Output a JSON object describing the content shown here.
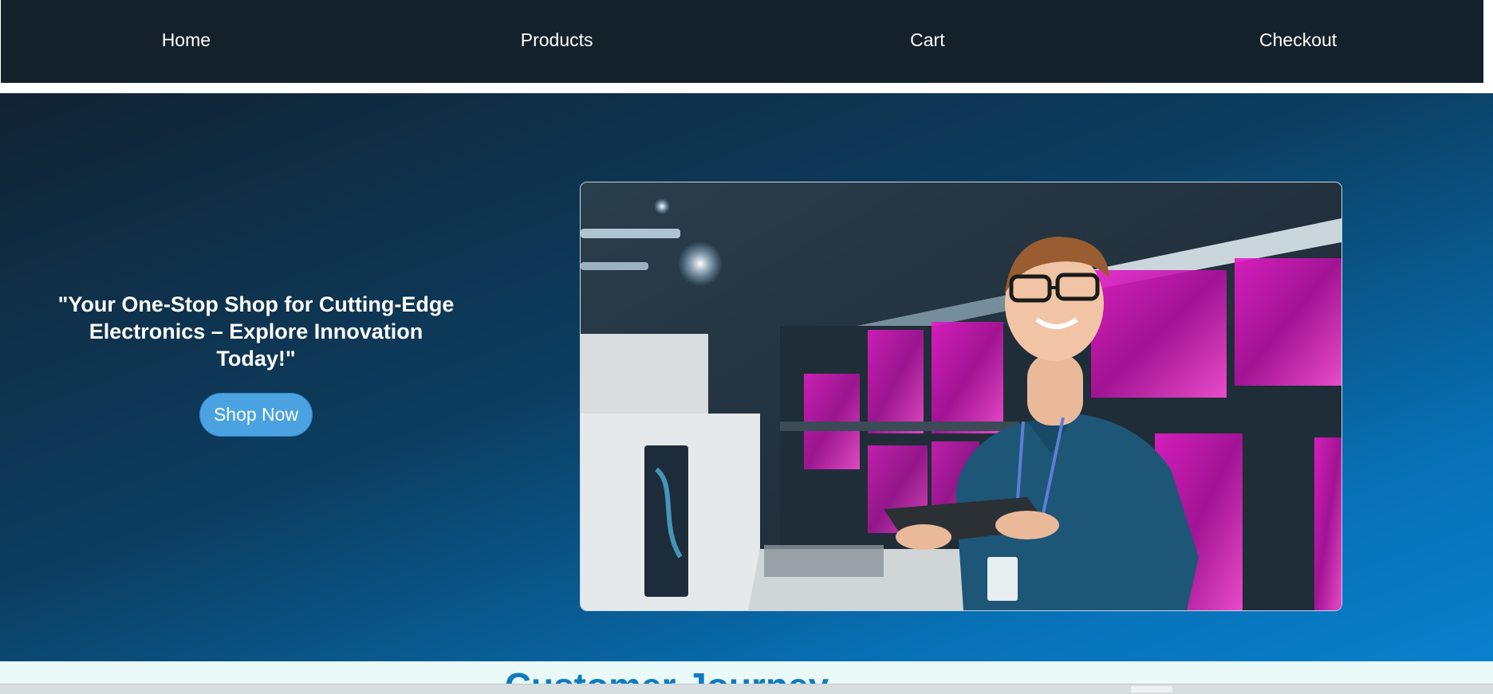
{
  "nav": {
    "items": [
      {
        "label": "Home"
      },
      {
        "label": "Products"
      },
      {
        "label": "Cart"
      },
      {
        "label": "Checkout"
      }
    ]
  },
  "hero": {
    "tagline": "\"Your One-Stop Shop for Cutting-Edge Electronics – Explore Innovation Today!\"",
    "cta_label": "Shop Now",
    "image_icon": "store-employee-photo"
  },
  "journey": {
    "title": "Customer Journey"
  },
  "colors": {
    "nav_bg": "#14212b",
    "cta_bg": "#4aa3e0",
    "section_title": "#0e7bc0"
  }
}
